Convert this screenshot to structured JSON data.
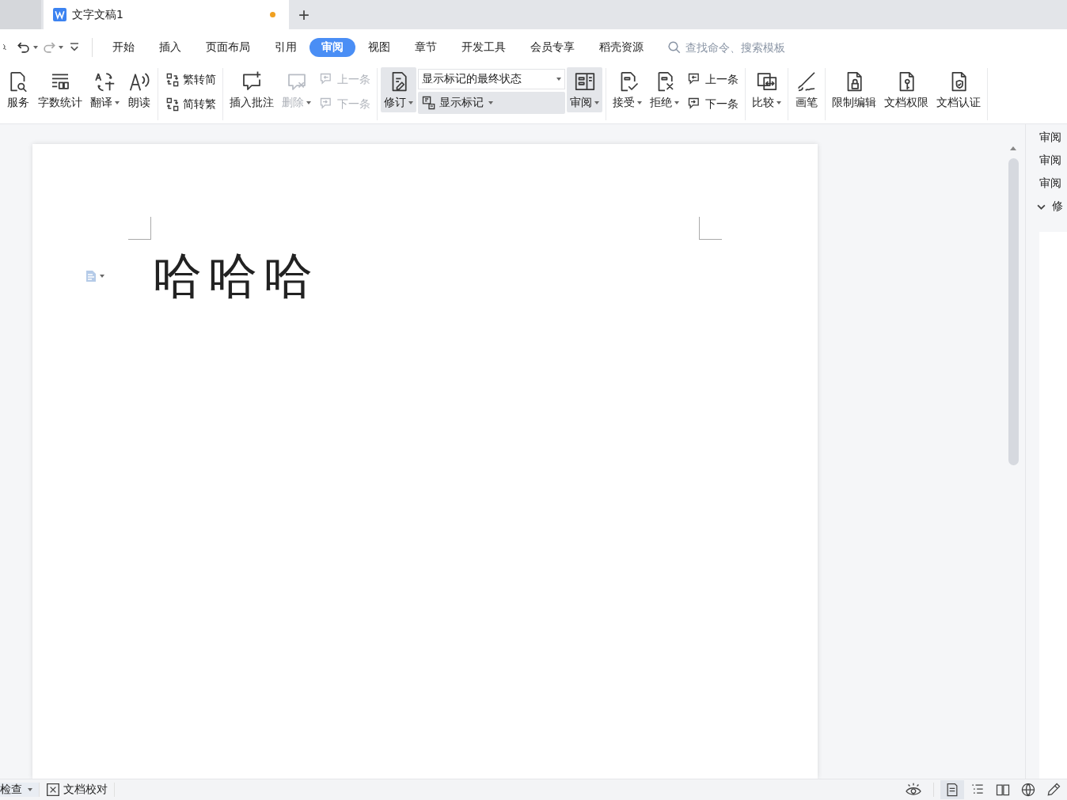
{
  "tabs": [
    {
      "title": "文字文稿1",
      "selected": true,
      "modified": true
    }
  ],
  "new_tab_button": "+",
  "menu": {
    "items": [
      {
        "label": "开始",
        "selected": false
      },
      {
        "label": "插入",
        "selected": false
      },
      {
        "label": "页面布局",
        "selected": false
      },
      {
        "label": "引用",
        "selected": false
      },
      {
        "label": "审阅",
        "selected": true
      },
      {
        "label": "视图",
        "selected": false
      },
      {
        "label": "章节",
        "selected": false
      },
      {
        "label": "开发工具",
        "selected": false
      },
      {
        "label": "会员专享",
        "selected": false
      },
      {
        "label": "稻壳资源",
        "selected": false
      }
    ],
    "search": {
      "placeholder": "查找命令、搜索模板"
    }
  },
  "ribbon": {
    "groups": [
      {
        "columns": [
          {
            "kind": "large",
            "label": "服务",
            "caret": false,
            "disabled": false,
            "on": false
          },
          {
            "kind": "large",
            "label": "字数统计",
            "caret": false,
            "disabled": false,
            "on": false
          },
          {
            "kind": "large",
            "label": "翻译",
            "caret": true,
            "disabled": false,
            "on": false
          },
          {
            "kind": "large",
            "label": "朗读",
            "caret": false,
            "disabled": false,
            "on": false
          }
        ]
      },
      {
        "columns": [
          {
            "kind": "stack",
            "items": [
              {
                "kind": "small",
                "label": "繁转简",
                "caret": false,
                "disabled": false,
                "on": false
              },
              {
                "kind": "small",
                "label": "简转繁",
                "caret": false,
                "disabled": false,
                "on": false
              }
            ]
          }
        ]
      },
      {
        "columns": [
          {
            "kind": "large",
            "label": "插入批注",
            "caret": false,
            "disabled": false,
            "on": false
          },
          {
            "kind": "large",
            "label": "删除",
            "caret": true,
            "disabled": true,
            "on": false
          },
          {
            "kind": "stack",
            "items": [
              {
                "kind": "small",
                "label": "上一条",
                "caret": false,
                "disabled": true,
                "on": false
              },
              {
                "kind": "small",
                "label": "下一条",
                "caret": false,
                "disabled": true,
                "on": false
              }
            ]
          }
        ]
      },
      {
        "columns": [
          {
            "kind": "large",
            "label": "修订",
            "caret": true,
            "disabled": false,
            "on": true
          },
          {
            "kind": "stack",
            "items": [
              {
                "kind": "select",
                "label": "显示标记的最终状态"
              },
              {
                "kind": "small",
                "label": "显示标记",
                "caret": true,
                "disabled": false,
                "on": true
              }
            ]
          },
          {
            "kind": "large",
            "label": "审阅",
            "caret": true,
            "disabled": false,
            "on": true
          }
        ]
      },
      {
        "columns": [
          {
            "kind": "large",
            "label": "接受",
            "caret": true,
            "disabled": false,
            "on": false
          },
          {
            "kind": "large",
            "label": "拒绝",
            "caret": true,
            "disabled": false,
            "on": false
          },
          {
            "kind": "stack",
            "items": [
              {
                "kind": "small",
                "label": "上一条",
                "caret": false,
                "disabled": false,
                "on": false
              },
              {
                "kind": "small",
                "label": "下一条",
                "caret": false,
                "disabled": false,
                "on": false
              }
            ]
          }
        ]
      },
      {
        "columns": [
          {
            "kind": "large",
            "label": "比较",
            "caret": true,
            "disabled": false,
            "on": false
          }
        ]
      },
      {
        "columns": [
          {
            "kind": "large",
            "label": "画笔",
            "caret": false,
            "disabled": false,
            "on": false
          }
        ]
      },
      {
        "columns": [
          {
            "kind": "large",
            "label": "限制编辑",
            "caret": false,
            "disabled": false,
            "on": false
          },
          {
            "kind": "large",
            "label": "文档权限",
            "caret": false,
            "disabled": false,
            "on": false
          },
          {
            "kind": "large",
            "label": "文档认证",
            "caret": false,
            "disabled": false,
            "on": false
          }
        ]
      }
    ]
  },
  "document": {
    "text": "哈哈哈"
  },
  "side_panel": {
    "rows": [
      {
        "kind": "text",
        "label": "审阅"
      },
      {
        "kind": "text",
        "label": "审阅"
      },
      {
        "kind": "text",
        "label": "审阅"
      },
      {
        "kind": "section",
        "label": "修",
        "expanded": true
      }
    ]
  },
  "status_bar": {
    "left": [
      {
        "label": "检查",
        "caret": true
      },
      {
        "label": "文档校对",
        "caret": false
      }
    ],
    "views": [
      {
        "selected": true
      },
      {
        "selected": false
      },
      {
        "selected": false
      },
      {
        "selected": false
      },
      {
        "selected": false
      }
    ]
  }
}
